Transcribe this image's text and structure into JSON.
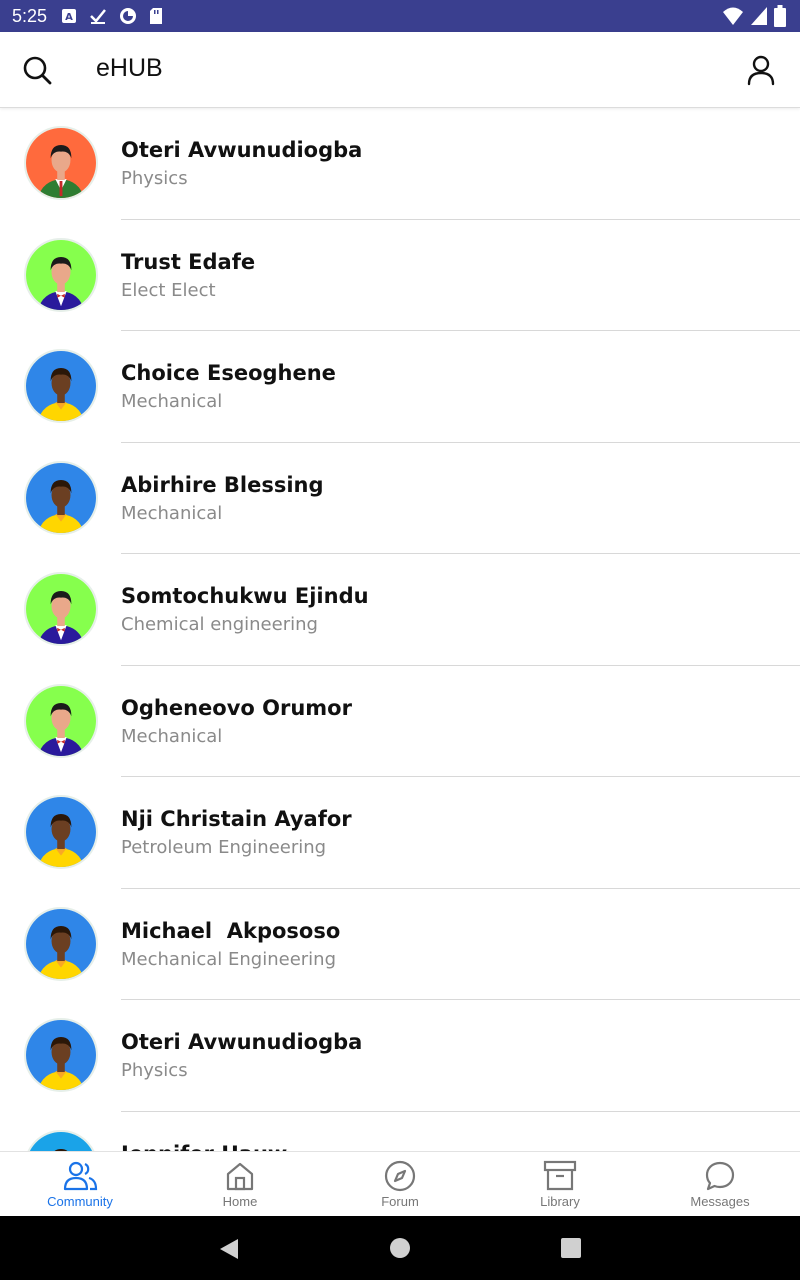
{
  "status_bar": {
    "time": "5:25",
    "left_icons": [
      "keyboard-a-icon",
      "checkmark-icon",
      "vpn-icon",
      "sd-card-icon"
    ],
    "right_icons": [
      "wifi-icon",
      "signal-icon",
      "battery-icon"
    ],
    "color": "#3a3f8f"
  },
  "app_bar": {
    "title": "eHUB",
    "search_icon": "search-icon",
    "profile_icon": "profile-icon"
  },
  "contacts": [
    {
      "name": "Oteri Avwunudiogba",
      "department": "Physics",
      "avatar_bg": "#ff6a3d",
      "avatar_style": "suit-green"
    },
    {
      "name": "Trust Edafe",
      "department": "Elect Elect",
      "avatar_bg": "#86ff4d",
      "avatar_style": "suit-purple"
    },
    {
      "name": "Choice Eseoghene",
      "department": "Mechanical",
      "avatar_bg": "#2f86e8",
      "avatar_style": "yellow-shirt"
    },
    {
      "name": "Abirhire Blessing",
      "department": "Mechanical",
      "avatar_bg": "#2f86e8",
      "avatar_style": "yellow-shirt"
    },
    {
      "name": "Somtochukwu Ejindu",
      "department": "Chemical engineering",
      "avatar_bg": "#86ff4d",
      "avatar_style": "suit-purple"
    },
    {
      "name": "Ogheneovo Orumor",
      "department": "Mechanical",
      "avatar_bg": "#86ff4d",
      "avatar_style": "suit-purple"
    },
    {
      "name": "Nji Christain Ayafor",
      "department": "Petroleum Engineering",
      "avatar_bg": "#2f86e8",
      "avatar_style": "yellow-shirt"
    },
    {
      "name": "Michael  Akpososo",
      "department": "Mechanical Engineering",
      "avatar_bg": "#2f86e8",
      "avatar_style": "yellow-shirt"
    },
    {
      "name": "Oteri Avwunudiogba",
      "department": "Physics",
      "avatar_bg": "#2f86e8",
      "avatar_style": "yellow-shirt"
    },
    {
      "name": "Jennifer Hauw",
      "department": "",
      "avatar_bg": "#1aa3e8",
      "avatar_style": "yellow-shirt"
    }
  ],
  "bottom_nav": {
    "active_color": "#1a73e8",
    "items": [
      {
        "label": "Community",
        "icon": "community-icon",
        "active": true
      },
      {
        "label": "Home",
        "icon": "home-icon",
        "active": false
      },
      {
        "label": "Forum",
        "icon": "compass-icon",
        "active": false
      },
      {
        "label": "Library",
        "icon": "archive-icon",
        "active": false
      },
      {
        "label": "Messages",
        "icon": "chat-bubble-icon",
        "active": false
      }
    ]
  },
  "system_nav": {
    "buttons": [
      "back-icon",
      "home-circle-icon",
      "recents-icon"
    ]
  }
}
